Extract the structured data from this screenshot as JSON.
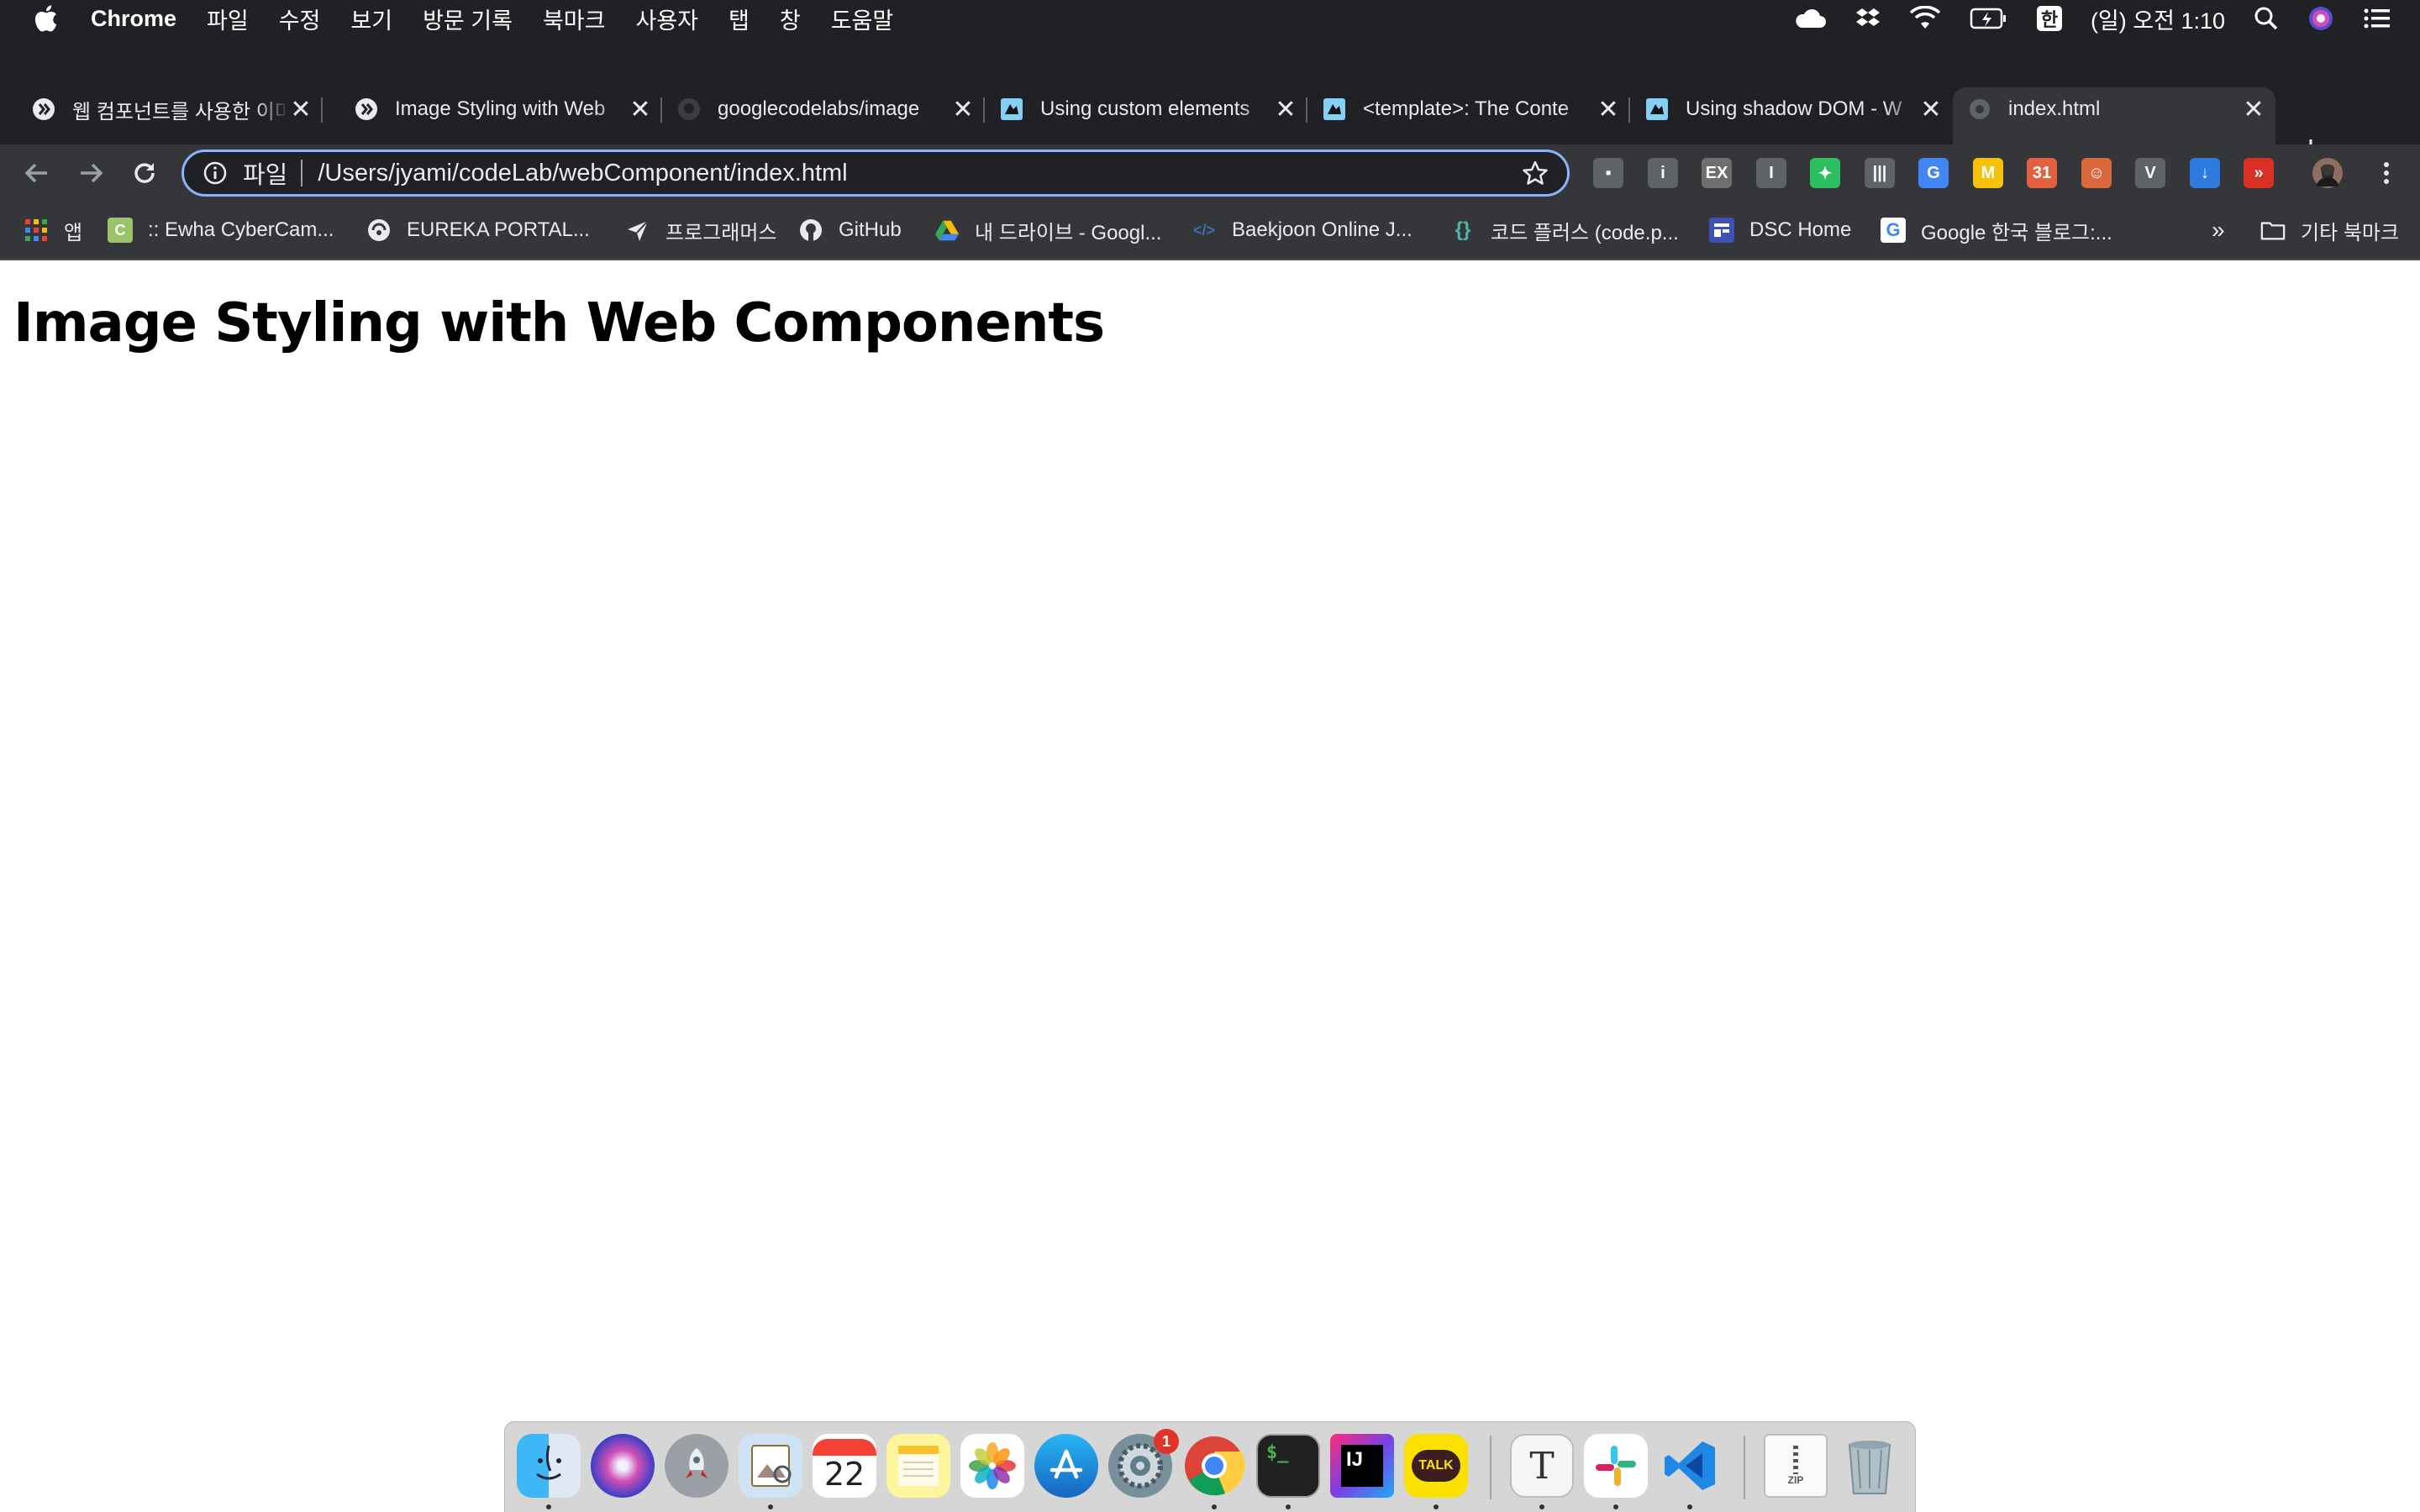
{
  "menubar": {
    "app_name": "Chrome",
    "items": [
      "파일",
      "수정",
      "보기",
      "방문 기록",
      "북마크",
      "사용자",
      "탭",
      "창",
      "도움말"
    ],
    "input_method": "한",
    "clock": "(일) 오전 1:10"
  },
  "tabs": [
    {
      "title": "웹 컴포넌트를 사용한 이미지",
      "favicon": "webcomponents-icon"
    },
    {
      "title": "Image Styling with Web",
      "favicon": "webcomponents-icon"
    },
    {
      "title": "googlecodelabs/image",
      "favicon": "github-icon"
    },
    {
      "title": "Using custom elements",
      "favicon": "mdn-icon"
    },
    {
      "title": "<template>: The Conte",
      "favicon": "mdn-icon"
    },
    {
      "title": "Using shadow DOM - W",
      "favicon": "mdn-icon"
    },
    {
      "title": "index.html",
      "favicon": "globe-icon",
      "active": true
    }
  ],
  "omnibox": {
    "scheme_label": "파일",
    "url": "/Users/jyami/codeLab/webComponent/index.html"
  },
  "extensions": [
    {
      "name": "screen-extension-icon",
      "label": "▪",
      "color": "#5f6368"
    },
    {
      "name": "info-extension-icon",
      "label": "i",
      "color": "#5f6368"
    },
    {
      "name": "ex-extension-icon",
      "label": "EX",
      "color": "#6e6e6e"
    },
    {
      "name": "bar-extension-icon",
      "label": "I",
      "color": "#5f6368"
    },
    {
      "name": "evernote-icon",
      "label": "✦",
      "color": "#2dbe60"
    },
    {
      "name": "barcode-extension-icon",
      "label": "|||",
      "color": "#5f6368"
    },
    {
      "name": "google-translate-icon",
      "label": "G",
      "color": "#4285f4"
    },
    {
      "name": "m-extension-icon",
      "label": "M",
      "color": "#f4c20d"
    },
    {
      "name": "calendar-extension-icon",
      "label": "31",
      "color": "#e06040"
    },
    {
      "name": "mascot-extension-icon",
      "label": "☺",
      "color": "#d9683c"
    },
    {
      "name": "vimeo-extension-icon",
      "label": "V",
      "color": "#5f6368"
    },
    {
      "name": "download-extension-icon",
      "label": "↓",
      "color": "#2e7be0"
    },
    {
      "name": "forward-extension-icon",
      "label": "»",
      "color": "#d93025"
    }
  ],
  "bookmarks": {
    "items": [
      {
        "label": "앱",
        "icon": "apps-grid-icon"
      },
      {
        "label": ":: Ewha CyberCam...",
        "icon": "ewha-icon"
      },
      {
        "label": "EUREKA PORTAL...",
        "icon": "eureka-icon"
      },
      {
        "label": "프로그래머스",
        "icon": "programmers-icon"
      },
      {
        "label": "GitHub",
        "icon": "github-icon"
      },
      {
        "label": "내 드라이브 - Googl...",
        "icon": "google-drive-icon"
      },
      {
        "label": "Baekjoon Online J...",
        "icon": "baekjoon-icon"
      },
      {
        "label": "코드 플러스 (code.p...",
        "icon": "codeplus-icon"
      },
      {
        "label": "DSC Home",
        "icon": "dsc-icon"
      },
      {
        "label": "Google 한국 블로그:...",
        "icon": "google-icon"
      }
    ],
    "overflow": "»",
    "other_folder": "기타 북마크"
  },
  "page": {
    "heading": "Image Styling with Web Components"
  },
  "dock": {
    "apps": [
      {
        "name": "finder-icon",
        "running": true
      },
      {
        "name": "siri-icon",
        "running": false
      },
      {
        "name": "launchpad-icon",
        "running": false
      },
      {
        "name": "preview-icon",
        "running": true
      },
      {
        "name": "calendar-icon",
        "label": "22",
        "running": false
      },
      {
        "name": "notes-icon",
        "running": false
      },
      {
        "name": "photos-icon",
        "running": false
      },
      {
        "name": "app-store-icon",
        "running": false
      },
      {
        "name": "system-preferences-icon",
        "badge": "1",
        "running": false
      },
      {
        "name": "chrome-icon",
        "running": true
      },
      {
        "name": "terminal-icon",
        "running": true
      },
      {
        "name": "intellij-icon",
        "label": "IJ",
        "running": false
      },
      {
        "name": "kakaotalk-icon",
        "label": "TALK",
        "running": true
      },
      {
        "name": "typora-icon",
        "label": "T",
        "running": true
      },
      {
        "name": "slack-icon",
        "running": true
      },
      {
        "name": "vscode-icon",
        "running": true
      },
      {
        "name": "archive-zip-icon",
        "label": "ZIP",
        "running": false
      },
      {
        "name": "trash-icon",
        "running": false
      }
    ]
  }
}
